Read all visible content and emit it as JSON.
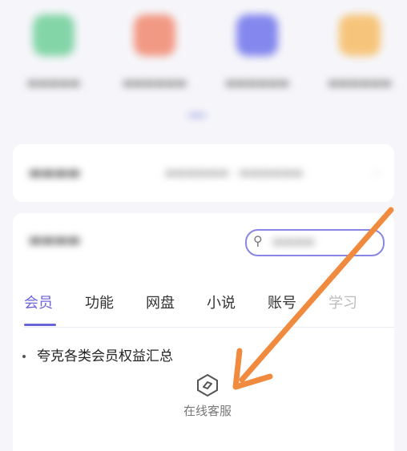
{
  "top_apps": [
    {
      "icon": "app-icon-green",
      "color": "#5cc98b"
    },
    {
      "icon": "app-icon-red",
      "color": "#f07a5c"
    },
    {
      "icon": "app-icon-blue",
      "color": "#5d62e8"
    },
    {
      "icon": "app-icon-orange",
      "color": "#f6b450"
    }
  ],
  "faq": {
    "tabs": [
      "会员",
      "功能",
      "网盘",
      "小说",
      "账号",
      "学习"
    ],
    "active_tab_index": 0,
    "items": [
      "夸克各类会员权益汇总"
    ]
  },
  "customer_service": {
    "label": "在线客服",
    "icon": "customer-service-icon"
  },
  "annotation": {
    "type": "arrow",
    "color": "#f08a3e",
    "points_to": "customer-service-button"
  },
  "colors": {
    "accent": "#6a63d9",
    "background": "#f6f6fa"
  }
}
